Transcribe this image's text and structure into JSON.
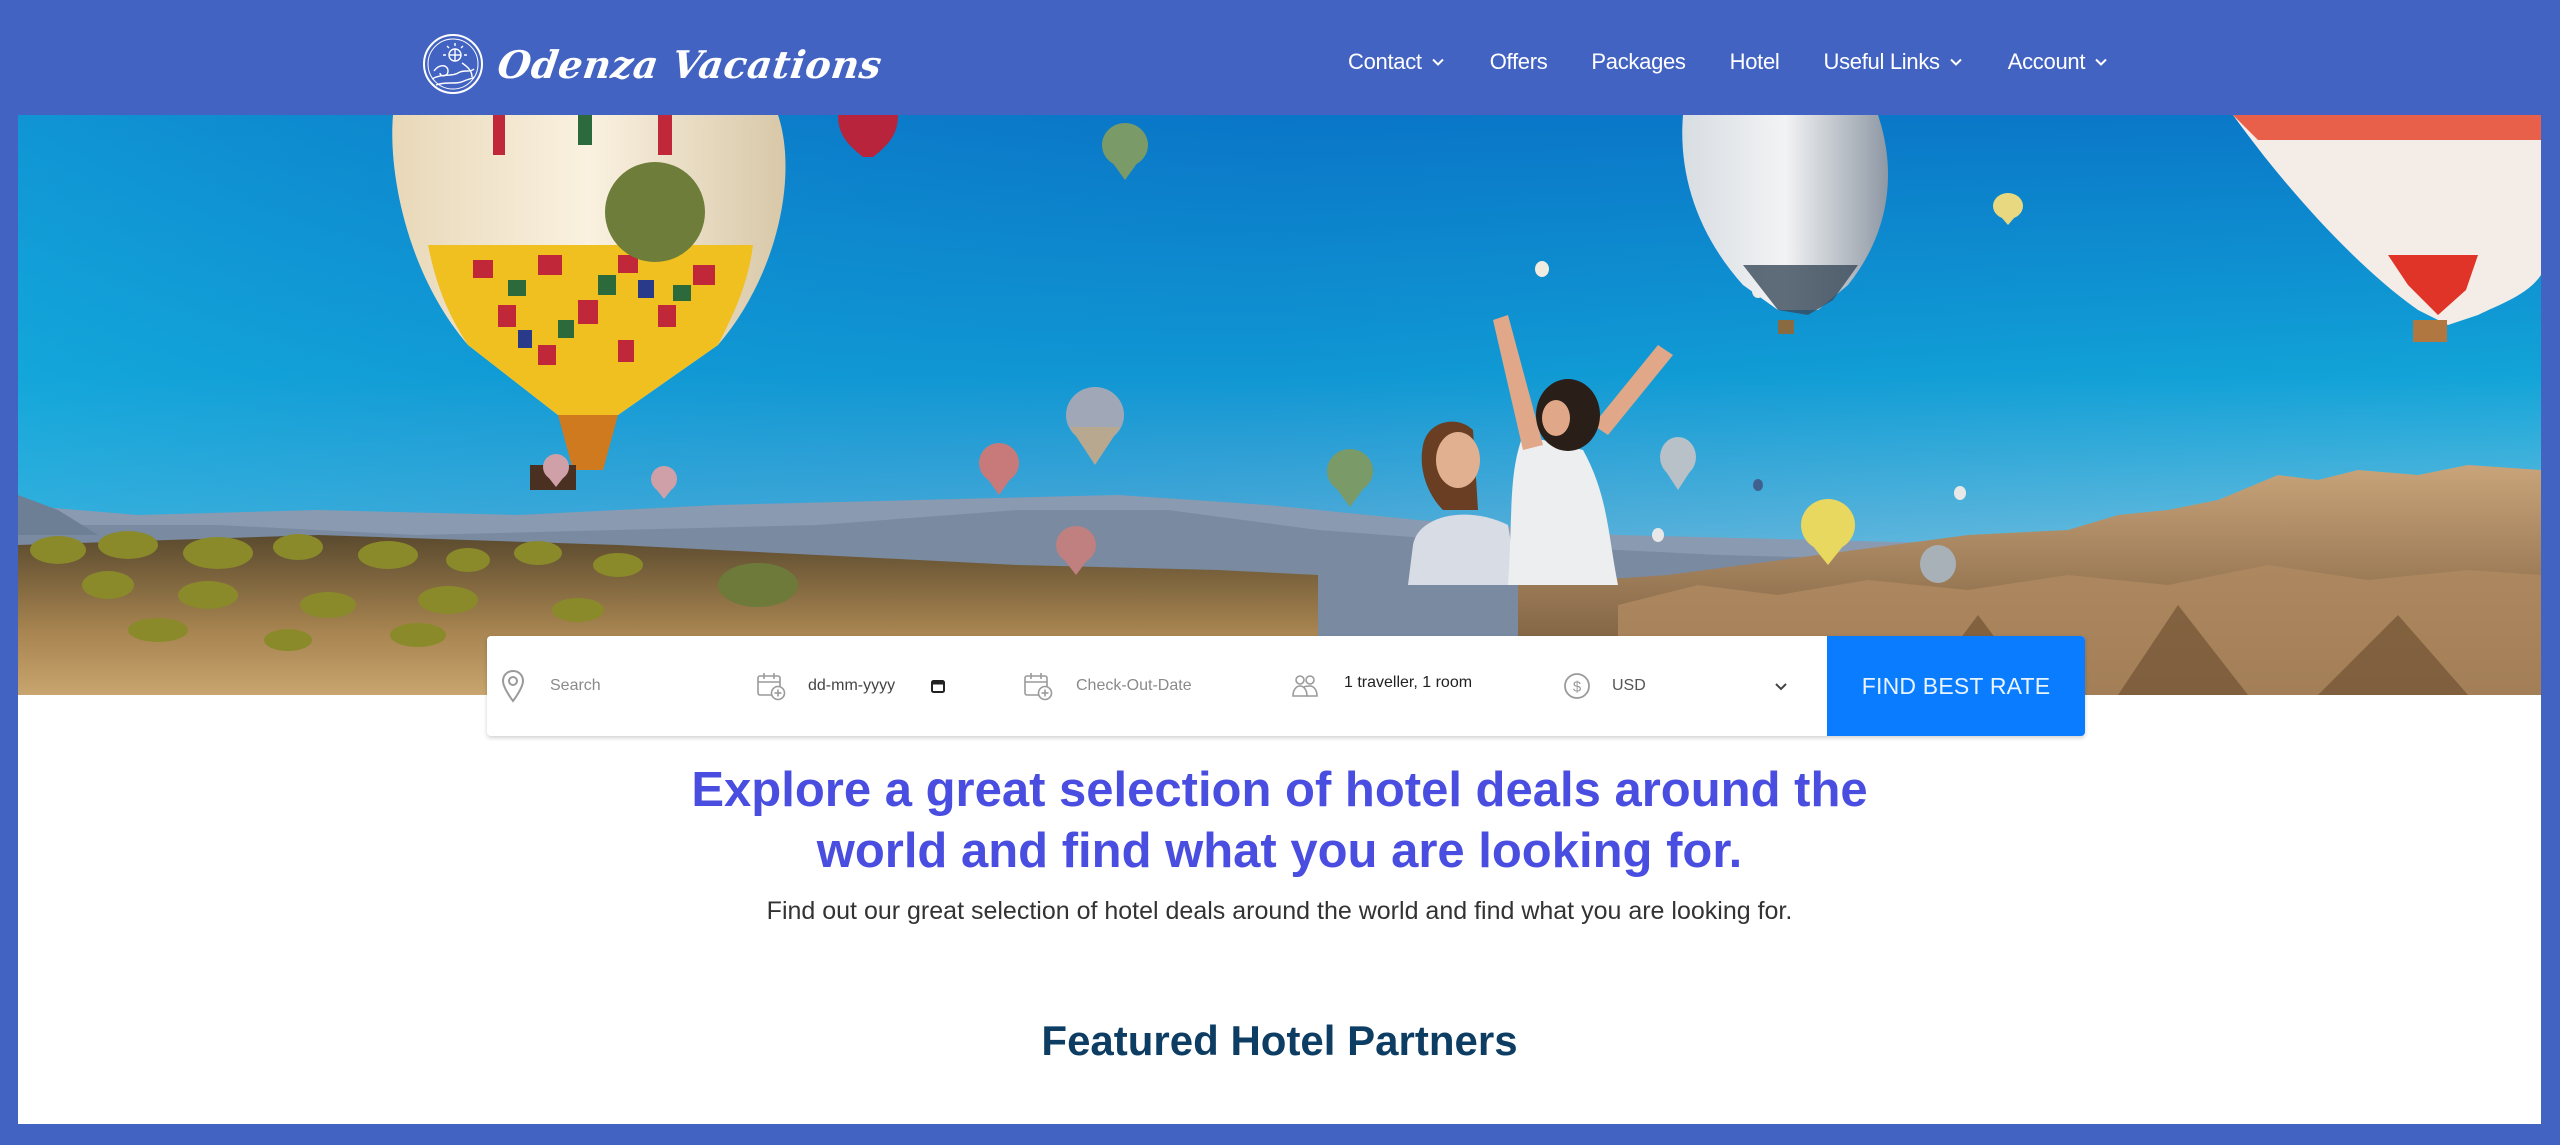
{
  "brand": {
    "name": "Odenza Vacations",
    "logo_icon": "sun-globe-wave-emblem",
    "header_color": "#4363c3"
  },
  "nav": {
    "items": [
      {
        "label": "Contact",
        "has_dropdown": true
      },
      {
        "label": "Offers",
        "has_dropdown": false
      },
      {
        "label": "Packages",
        "has_dropdown": false
      },
      {
        "label": "Hotel",
        "has_dropdown": false
      },
      {
        "label": "Useful Links",
        "has_dropdown": true
      },
      {
        "label": "Account",
        "has_dropdown": true
      }
    ]
  },
  "hero": {
    "image_description": "Couple celebrating among hot air balloons over Cappadocia landscape"
  },
  "search": {
    "destination": {
      "placeholder": "Search",
      "icon": "map-pin-icon"
    },
    "check_in": {
      "value": "dd-mm-yyyy",
      "icon": "calendar-add-icon",
      "picker_icon": "calendar-icon"
    },
    "check_out": {
      "placeholder": "Check-Out-Date",
      "icon": "calendar-add-icon"
    },
    "guests": {
      "value": "1 traveller, 1 room",
      "icon": "users-icon"
    },
    "currency": {
      "value": "USD",
      "icon": "dollar-circle-icon"
    },
    "submit_label": "FIND BEST RATE",
    "submit_color": "#0a7cff"
  },
  "main": {
    "headline_line1": "Explore a great selection of hotel deals around the",
    "headline_line2": "world and find what you are looking for.",
    "headline_color": "#4a4ee0",
    "subline": "Find out our great selection of hotel deals around the world and find what you are looking for.",
    "section_title": "Featured Hotel Partners"
  }
}
